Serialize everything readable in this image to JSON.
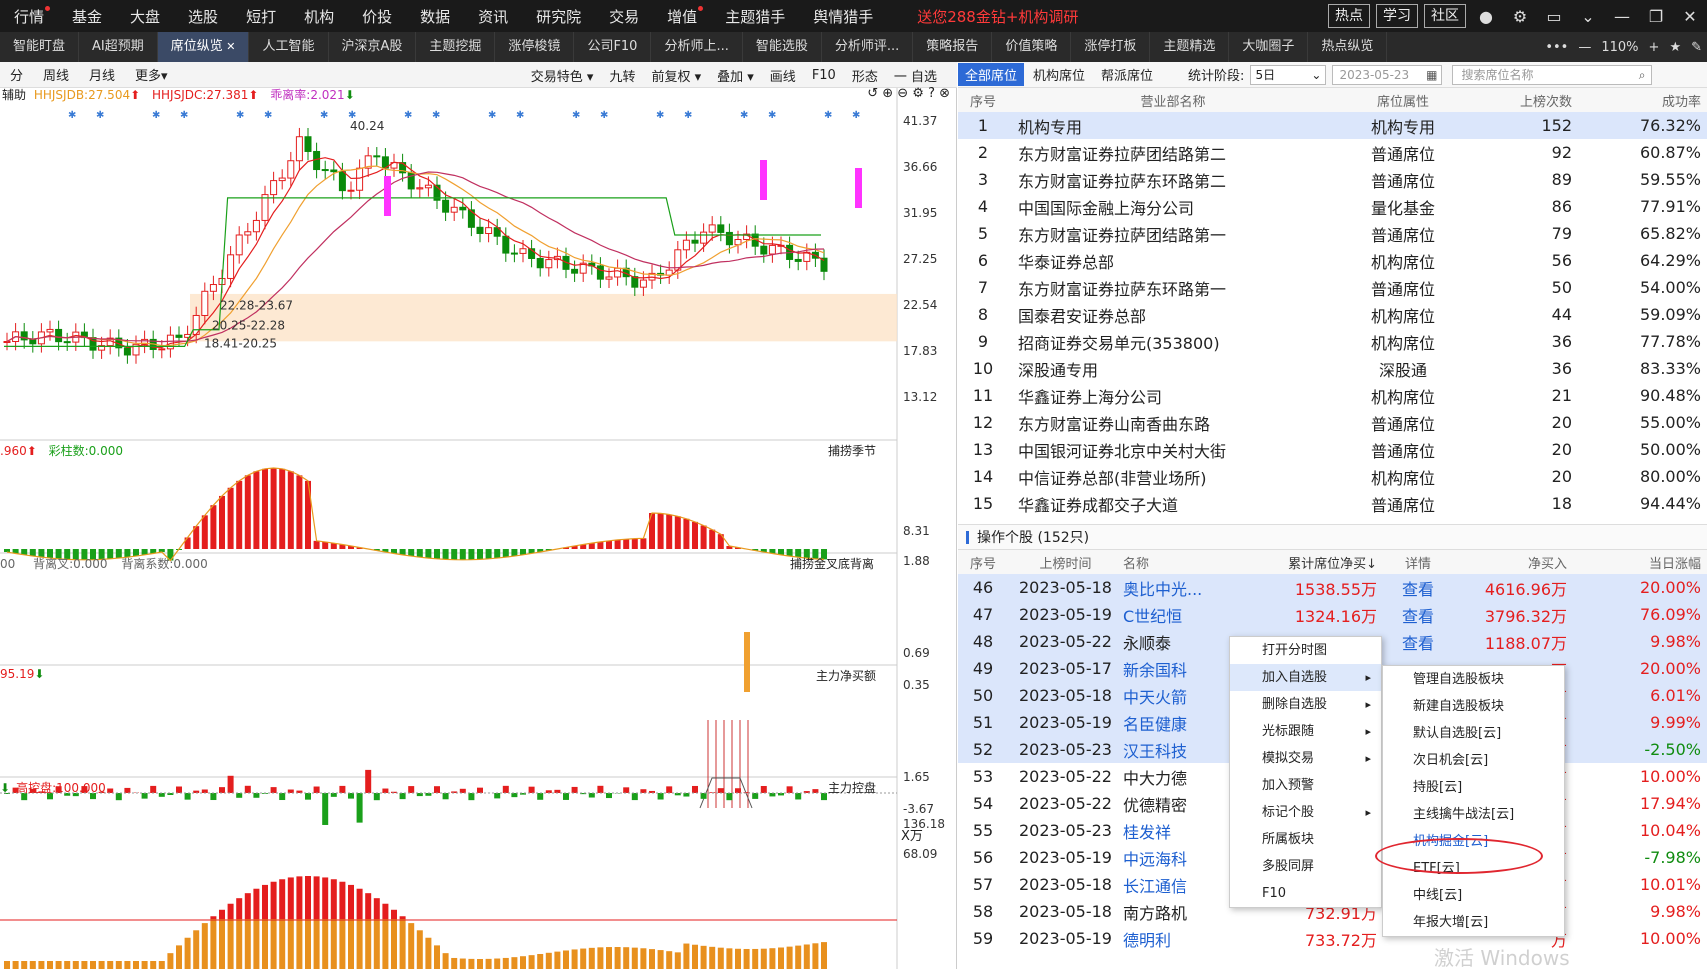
{
  "topbar": {
    "nav": [
      "行情",
      "基金",
      "大盘",
      "选股",
      "短打",
      "机构",
      "价投",
      "数据",
      "资讯",
      "研究院",
      "交易",
      "增值",
      "主题猎手",
      "舆情猎手"
    ],
    "nav_dot": [
      true,
      false,
      false,
      false,
      false,
      false,
      false,
      false,
      false,
      false,
      false,
      true,
      false,
      false
    ],
    "promo": "送您288金钻+机构调研",
    "buttons": [
      "热点",
      "学习",
      "社区"
    ]
  },
  "tabs": {
    "items": [
      "智能盯盘",
      "AI超预期",
      "席位纵览",
      "人工智能",
      "沪深京A股",
      "主题挖掘",
      "涨停梭镜",
      "公司F10",
      "分析师上...",
      "智能选股",
      "分析师评...",
      "策略报告",
      "价值策略",
      "涨停打板",
      "主题精选",
      "大咖圈子",
      "热点纵览"
    ],
    "active": 2,
    "zoom": "110%"
  },
  "chart_toolbar": {
    "left": [
      "分",
      "周线",
      "月线",
      "更多▾"
    ],
    "right": [
      "交易特色 ▾",
      "九转",
      "前复权 ▾",
      "叠加 ▾",
      "画线",
      "F10",
      "形态",
      "一 自选"
    ]
  },
  "chart": {
    "main_indicator": {
      "prefix": "辅助",
      "a": "HHJSJDB:27.504",
      "b": "HHJSJDC:27.381",
      "c": "乖离率:2.021"
    },
    "price_axis": [
      "41.37",
      "36.66",
      "31.95",
      "27.25",
      "22.54",
      "17.83",
      "13.12"
    ],
    "annotations": {
      "high": "40.24",
      "zone1": "22.28-23.67",
      "zone2": "20.25-22.28",
      "zone3": "18.41-20.25"
    },
    "panel2": {
      "head_left": ".960",
      "head_mid": "彩柱数:0.000",
      "title": "捕捞季节",
      "axis": [
        "8.31",
        "1.88"
      ]
    },
    "panel3": {
      "head_left": "00",
      "head_a": "背离叉:0.000",
      "head_b": "背离系数:0.000",
      "title": "捕捞金叉底背离",
      "axis": [
        "0.69",
        "0.35"
      ]
    },
    "panel4": {
      "head_left": "95.19",
      "title": "主力净买额",
      "axis": [
        "1.65",
        "-3.67"
      ],
      "unit": "X万"
    },
    "panel5": {
      "head_left": "高控盘:100.000",
      "title": "主力控盘",
      "axis": [
        "136.18",
        "68.09"
      ]
    }
  },
  "right_pane": {
    "tabs": [
      "全部席位",
      "机构席位",
      "帮派席位"
    ],
    "period_label": "统计阶段:",
    "period_value": "5日",
    "date": "2023-05-23",
    "search_placeholder": "搜索席位名称",
    "seat_headers": [
      "序号",
      "营业部名称",
      "席位属性",
      "上榜次数",
      "成功率"
    ],
    "seats": [
      [
        "1",
        "机构专用",
        "机构专用",
        "152",
        "76.32%"
      ],
      [
        "2",
        "东方财富证券拉萨团结路第二",
        "普通席位",
        "92",
        "60.87%"
      ],
      [
        "3",
        "东方财富证券拉萨东环路第二",
        "普通席位",
        "89",
        "59.55%"
      ],
      [
        "4",
        "中国国际金融上海分公司",
        "量化基金",
        "86",
        "77.91%"
      ],
      [
        "5",
        "东方财富证券拉萨团结路第一",
        "普通席位",
        "79",
        "65.82%"
      ],
      [
        "6",
        "华泰证券总部",
        "机构席位",
        "56",
        "64.29%"
      ],
      [
        "7",
        "东方财富证券拉萨东环路第一",
        "普通席位",
        "50",
        "54.00%"
      ],
      [
        "8",
        "国泰君安证券总部",
        "机构席位",
        "44",
        "59.09%"
      ],
      [
        "9",
        "招商证券交易单元(353800)",
        "机构席位",
        "36",
        "77.78%"
      ],
      [
        "10",
        "深股通专用",
        "深股通",
        "36",
        "83.33%"
      ],
      [
        "11",
        "华鑫证券上海分公司",
        "机构席位",
        "21",
        "90.48%"
      ],
      [
        "12",
        "东方财富证券山南香曲东路",
        "普通席位",
        "20",
        "55.00%"
      ],
      [
        "13",
        "中国银河证券北京中关村大街",
        "普通席位",
        "20",
        "50.00%"
      ],
      [
        "14",
        "中信证券总部(非营业场所)",
        "机构席位",
        "20",
        "80.00%"
      ],
      [
        "15",
        "华鑫证券成都交子大道",
        "普通席位",
        "18",
        "94.44%"
      ]
    ],
    "ops_title": "操作个股 (152只)",
    "ops_headers": [
      "序号",
      "上榜时间",
      "名称",
      "累计席位净买↓",
      "详情",
      "净买入",
      "当日涨幅"
    ],
    "ops": [
      [
        "46",
        "2023-05-18",
        "奥比中光...",
        "1538.55万",
        "查看",
        "4616.96万",
        "20.00%"
      ],
      [
        "47",
        "2023-05-19",
        "C世纪恒",
        "1324.16万",
        "查看",
        "3796.32万",
        "76.09%"
      ],
      [
        "48",
        "2023-05-22",
        "永顺泰",
        "",
        "查看",
        "1188.07万",
        "9.98%"
      ],
      [
        "49",
        "2023-05-17",
        "新余国科",
        "",
        "",
        "万",
        "20.00%"
      ],
      [
        "50",
        "2023-05-18",
        "中天火箭",
        "",
        "",
        "万",
        "6.01%"
      ],
      [
        "51",
        "2023-05-19",
        "名臣健康",
        "",
        "",
        "万",
        "9.99%"
      ],
      [
        "52",
        "2023-05-23",
        "汉王科技",
        "",
        "",
        "万",
        "-2.50%"
      ],
      [
        "53",
        "2023-05-22",
        "中大力德",
        "",
        "",
        "万",
        "10.00%"
      ],
      [
        "54",
        "2023-05-22",
        "优德精密",
        "",
        "",
        "万",
        "17.94%"
      ],
      [
        "55",
        "2023-05-23",
        "桂发祥",
        "",
        "",
        "万",
        "10.04%"
      ],
      [
        "56",
        "2023-05-19",
        "中远海科",
        "",
        "",
        "万",
        "-7.98%"
      ],
      [
        "57",
        "2023-05-18",
        "长江通信",
        "",
        "",
        "万",
        "10.01%"
      ],
      [
        "58",
        "2023-05-18",
        "南方路机",
        "732.91万",
        "",
        "万",
        "9.98%"
      ],
      [
        "59",
        "2023-05-19",
        "德明利",
        "733.72万",
        "",
        "万",
        "10.00%"
      ]
    ]
  },
  "context_menu": {
    "items": [
      "打开分时图",
      "加入自选股",
      "删除自选股",
      "光标跟随",
      "模拟交易",
      "加入预警",
      "标记个股",
      "所属板块",
      "多股同屏",
      "F10"
    ],
    "has_sub": [
      false,
      true,
      true,
      true,
      true,
      false,
      true,
      false,
      false,
      false
    ],
    "active": 1
  },
  "submenu": {
    "items": [
      "管理自选股板块",
      "新建自选股板块",
      "默认自选股[云]",
      "次日机会[云]",
      "持股[云]",
      "主线擒牛战法[云]",
      "机构掘金[云]",
      "ETF[云]",
      "中线[云]",
      "年报大增[云]"
    ],
    "highlighted": 6
  },
  "watermark": "激活 Windows"
}
